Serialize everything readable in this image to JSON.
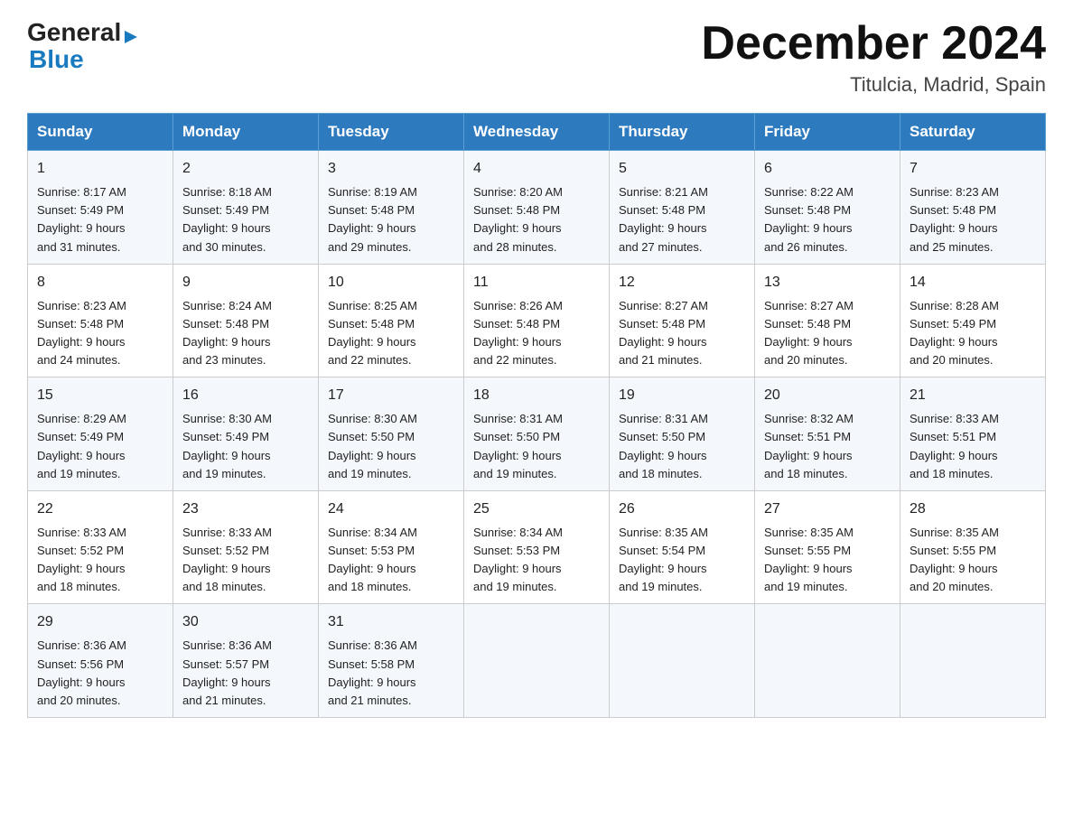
{
  "header": {
    "month_year": "December 2024",
    "location": "Titulcia, Madrid, Spain",
    "logo_general": "General",
    "logo_blue": "Blue"
  },
  "days_of_week": [
    "Sunday",
    "Monday",
    "Tuesday",
    "Wednesday",
    "Thursday",
    "Friday",
    "Saturday"
  ],
  "weeks": [
    [
      {
        "day": 1,
        "sunrise": "8:17 AM",
        "sunset": "5:49 PM",
        "daylight": "9 hours and 31 minutes."
      },
      {
        "day": 2,
        "sunrise": "8:18 AM",
        "sunset": "5:49 PM",
        "daylight": "9 hours and 30 minutes."
      },
      {
        "day": 3,
        "sunrise": "8:19 AM",
        "sunset": "5:48 PM",
        "daylight": "9 hours and 29 minutes."
      },
      {
        "day": 4,
        "sunrise": "8:20 AM",
        "sunset": "5:48 PM",
        "daylight": "9 hours and 28 minutes."
      },
      {
        "day": 5,
        "sunrise": "8:21 AM",
        "sunset": "5:48 PM",
        "daylight": "9 hours and 27 minutes."
      },
      {
        "day": 6,
        "sunrise": "8:22 AM",
        "sunset": "5:48 PM",
        "daylight": "9 hours and 26 minutes."
      },
      {
        "day": 7,
        "sunrise": "8:23 AM",
        "sunset": "5:48 PM",
        "daylight": "9 hours and 25 minutes."
      }
    ],
    [
      {
        "day": 8,
        "sunrise": "8:23 AM",
        "sunset": "5:48 PM",
        "daylight": "9 hours and 24 minutes."
      },
      {
        "day": 9,
        "sunrise": "8:24 AM",
        "sunset": "5:48 PM",
        "daylight": "9 hours and 23 minutes."
      },
      {
        "day": 10,
        "sunrise": "8:25 AM",
        "sunset": "5:48 PM",
        "daylight": "9 hours and 22 minutes."
      },
      {
        "day": 11,
        "sunrise": "8:26 AM",
        "sunset": "5:48 PM",
        "daylight": "9 hours and 22 minutes."
      },
      {
        "day": 12,
        "sunrise": "8:27 AM",
        "sunset": "5:48 PM",
        "daylight": "9 hours and 21 minutes."
      },
      {
        "day": 13,
        "sunrise": "8:27 AM",
        "sunset": "5:48 PM",
        "daylight": "9 hours and 20 minutes."
      },
      {
        "day": 14,
        "sunrise": "8:28 AM",
        "sunset": "5:49 PM",
        "daylight": "9 hours and 20 minutes."
      }
    ],
    [
      {
        "day": 15,
        "sunrise": "8:29 AM",
        "sunset": "5:49 PM",
        "daylight": "9 hours and 19 minutes."
      },
      {
        "day": 16,
        "sunrise": "8:30 AM",
        "sunset": "5:49 PM",
        "daylight": "9 hours and 19 minutes."
      },
      {
        "day": 17,
        "sunrise": "8:30 AM",
        "sunset": "5:50 PM",
        "daylight": "9 hours and 19 minutes."
      },
      {
        "day": 18,
        "sunrise": "8:31 AM",
        "sunset": "5:50 PM",
        "daylight": "9 hours and 19 minutes."
      },
      {
        "day": 19,
        "sunrise": "8:31 AM",
        "sunset": "5:50 PM",
        "daylight": "9 hours and 18 minutes."
      },
      {
        "day": 20,
        "sunrise": "8:32 AM",
        "sunset": "5:51 PM",
        "daylight": "9 hours and 18 minutes."
      },
      {
        "day": 21,
        "sunrise": "8:33 AM",
        "sunset": "5:51 PM",
        "daylight": "9 hours and 18 minutes."
      }
    ],
    [
      {
        "day": 22,
        "sunrise": "8:33 AM",
        "sunset": "5:52 PM",
        "daylight": "9 hours and 18 minutes."
      },
      {
        "day": 23,
        "sunrise": "8:33 AM",
        "sunset": "5:52 PM",
        "daylight": "9 hours and 18 minutes."
      },
      {
        "day": 24,
        "sunrise": "8:34 AM",
        "sunset": "5:53 PM",
        "daylight": "9 hours and 18 minutes."
      },
      {
        "day": 25,
        "sunrise": "8:34 AM",
        "sunset": "5:53 PM",
        "daylight": "9 hours and 19 minutes."
      },
      {
        "day": 26,
        "sunrise": "8:35 AM",
        "sunset": "5:54 PM",
        "daylight": "9 hours and 19 minutes."
      },
      {
        "day": 27,
        "sunrise": "8:35 AM",
        "sunset": "5:55 PM",
        "daylight": "9 hours and 19 minutes."
      },
      {
        "day": 28,
        "sunrise": "8:35 AM",
        "sunset": "5:55 PM",
        "daylight": "9 hours and 20 minutes."
      }
    ],
    [
      {
        "day": 29,
        "sunrise": "8:36 AM",
        "sunset": "5:56 PM",
        "daylight": "9 hours and 20 minutes."
      },
      {
        "day": 30,
        "sunrise": "8:36 AM",
        "sunset": "5:57 PM",
        "daylight": "9 hours and 21 minutes."
      },
      {
        "day": 31,
        "sunrise": "8:36 AM",
        "sunset": "5:58 PM",
        "daylight": "9 hours and 21 minutes."
      },
      null,
      null,
      null,
      null
    ]
  ],
  "labels": {
    "sunrise": "Sunrise:",
    "sunset": "Sunset:",
    "daylight": "Daylight:"
  }
}
